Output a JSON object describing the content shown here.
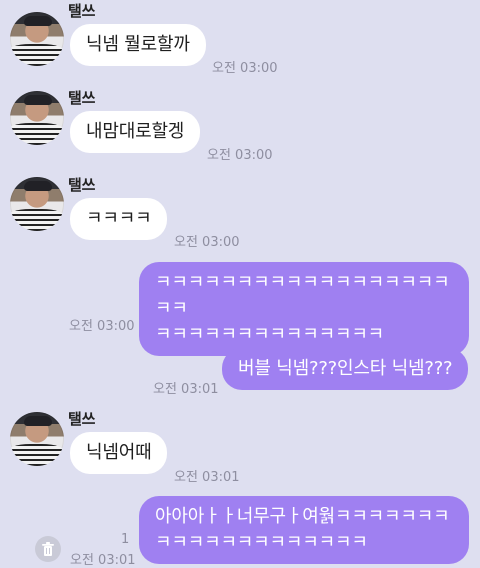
{
  "messages": [
    {
      "sender": "탤쓰",
      "text": "닉넴 뭘로할까",
      "time": "오전 03:00"
    },
    {
      "sender": "탤쓰",
      "text": "내맘대로할겡",
      "time": "오전 03:00"
    },
    {
      "sender": "탤쓰",
      "text": "ㅋㅋㅋㅋ",
      "time": "오전 03:00"
    },
    {
      "text": "ㅋㅋㅋㅋㅋㅋㅋㅋㅋㅋㅋㅋㅋㅋㅋㅋㅋㅋㅋㅋ\nㅋㅋㅋㅋㅋㅋㅋㅋㅋㅋㅋㅋㅋㅋ",
      "time": "오전 03:00"
    },
    {
      "text": "버블 닉넴???인스타 닉넴???",
      "time": "오전 03:01"
    },
    {
      "sender": "탤쓰",
      "text": "닉넴어때",
      "time": "오전 03:01"
    },
    {
      "text": "아아아ㅏㅏ너무구ㅏ여웕ㅋㅋㅋㅋㅋㅋㅋ\nㅋㅋㅋㅋㅋㅋㅋㅋㅋㅋㅋㅋㅋ",
      "time": "오전 03:01",
      "read_count": "1"
    }
  ],
  "icons": {
    "avatar": "profile-photo-avatar",
    "trash": "trash-icon"
  },
  "colors": {
    "background": "#dedff0",
    "incoming_bubble": "#ffffff",
    "outgoing_bubble": "#9f80f1",
    "time_text": "#8e8ea0"
  }
}
